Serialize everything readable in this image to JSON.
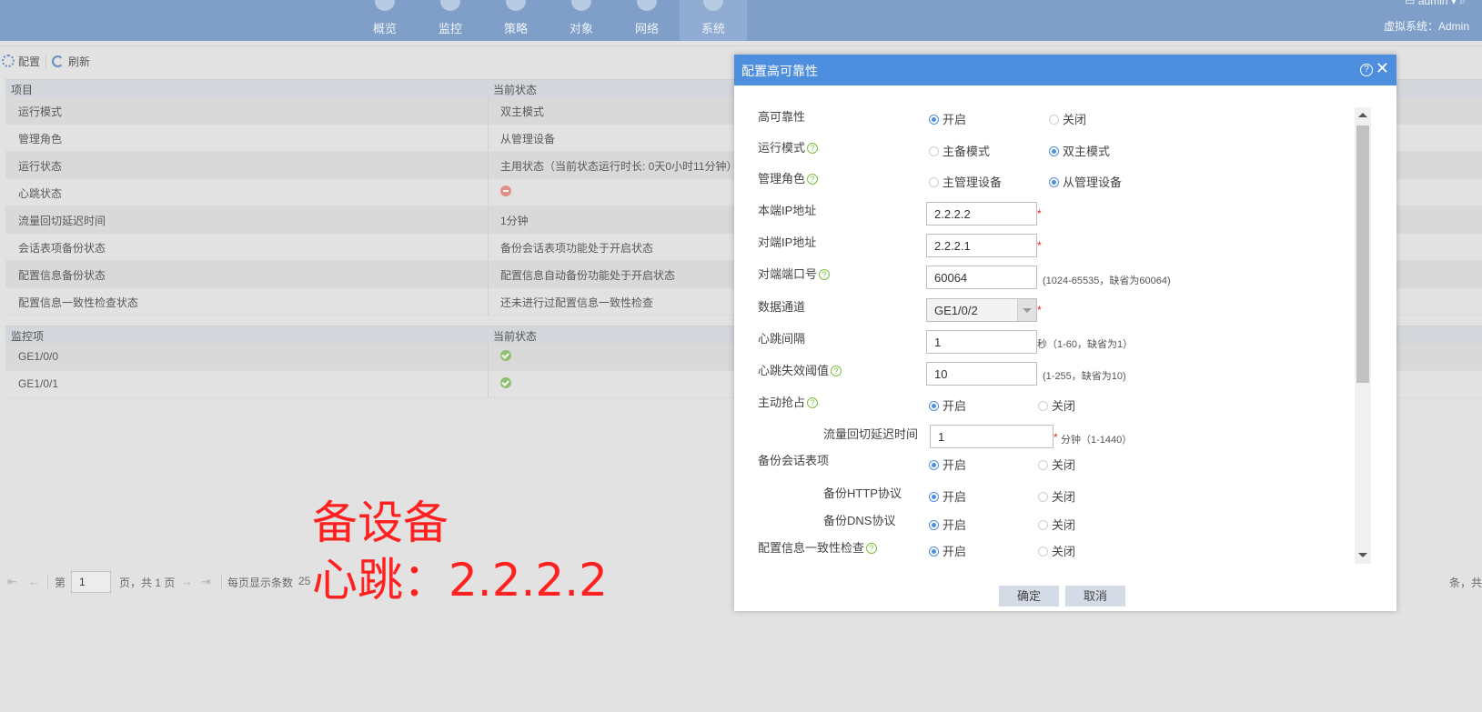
{
  "nav": {
    "items": [
      {
        "label": "概览"
      },
      {
        "label": "监控"
      },
      {
        "label": "策略"
      },
      {
        "label": "对象"
      },
      {
        "label": "网络"
      },
      {
        "label": "系统"
      }
    ],
    "active": "系统",
    "user": "admin",
    "vsys": "虚拟系统：Admin"
  },
  "toolbar": {
    "config_label": "配置",
    "refresh_label": "刷新"
  },
  "status_table": {
    "headers": [
      "项目",
      "当前状态"
    ],
    "rows": [
      {
        "item": "运行模式",
        "status": "双主模式"
      },
      {
        "item": "管理角色",
        "status": "从管理设备"
      },
      {
        "item": "运行状态",
        "status": "主用状态（当前状态运行时长: 0天0小时11分钟）"
      },
      {
        "item": "心跳状态",
        "status": "",
        "status_icon": "error-icon"
      },
      {
        "item": "流量回切延迟时间",
        "status": "1分钟"
      },
      {
        "item": "会话表项备份状态",
        "status": "备份会话表项功能处于开启状态"
      },
      {
        "item": "配置信息备份状态",
        "status": "配置信息自动备份功能处于开启状态"
      },
      {
        "item": "配置信息一致性检查状态",
        "status": "还未进行过配置信息一致性检查"
      }
    ]
  },
  "monitor_table": {
    "headers": [
      "监控项",
      "当前状态"
    ],
    "rows": [
      {
        "item": "GE1/0/0",
        "status_icon": "ok-icon"
      },
      {
        "item": "GE1/0/1",
        "status_icon": "ok-icon"
      }
    ]
  },
  "pager": {
    "page_prefix": "第",
    "page_value": "1",
    "page_suffix": "页，共 1 页",
    "per_page_label": "每页显示条数",
    "per_page_value": "25",
    "right_text": "条，共"
  },
  "annotation": {
    "line1": "备设备",
    "line2": "心跳：2.2.2.2",
    "color": "#ff2020"
  },
  "dialog": {
    "title": "配置高可靠性",
    "ha_label": "高可靠性",
    "ha_on": "开启",
    "ha_off": "关闭",
    "mode_label": "运行模式",
    "mode_opt1": "主备模式",
    "mode_opt2": "双主模式",
    "role_label": "管理角色",
    "role_opt1": "主管理设备",
    "role_opt2": "从管理设备",
    "local_ip_label": "本端IP地址",
    "local_ip": "2.2.2.2",
    "peer_ip_label": "对端IP地址",
    "peer_ip": "2.2.2.1",
    "peer_port_label": "对端端口号",
    "peer_port": "60064",
    "peer_port_hint": "(1024-65535，缺省为60064)",
    "data_channel_label": "数据通道",
    "data_channel": "GE1/0/2",
    "hb_interval_label": "心跳间隔",
    "hb_interval": "1",
    "hb_interval_hint": "秒（1-60，缺省为1）",
    "hb_fail_label": "心跳失效阈值",
    "hb_fail": "10",
    "hb_fail_hint": "(1-255，缺省为10)",
    "preempt_label": "主动抢占",
    "preempt_on": "开启",
    "preempt_off": "关闭",
    "switchback_label": "流量回切延迟时间",
    "switchback": "1",
    "switchback_hint": "分钟（1-1440）",
    "session_backup_label": "备份会话表项",
    "session_on": "开启",
    "session_off": "关闭",
    "http_label": "备份HTTP协议",
    "http_on": "开启",
    "http_off": "关闭",
    "dns_label": "备份DNS协议",
    "dns_on": "开启",
    "dns_off": "关闭",
    "consistency_label": "配置信息一致性检查",
    "consistency_on": "开启",
    "consistency_off": "关闭",
    "ok_label": "确定",
    "cancel_label": "取消",
    "help_symbol": "?",
    "close_symbol": "✕",
    "required_mark": "*",
    "accent_color": "#4e8ede"
  }
}
